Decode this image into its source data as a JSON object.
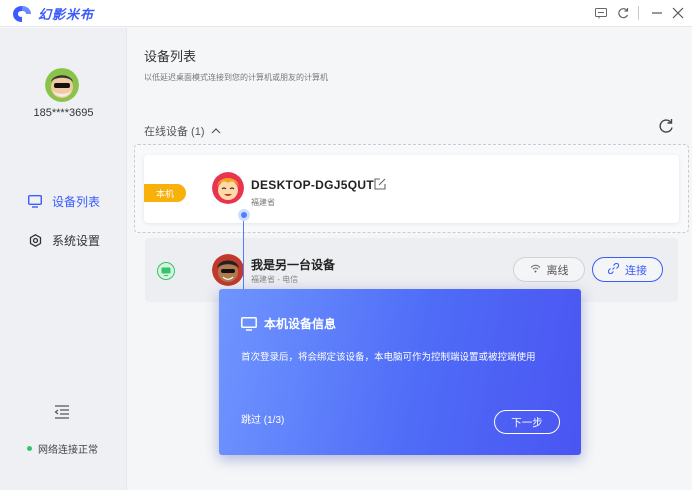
{
  "app": {
    "name": "幻影米布"
  },
  "window_controls": [
    {
      "name": "feedback-icon"
    },
    {
      "name": "refresh-app-icon"
    },
    {
      "name": "minimize-icon"
    },
    {
      "name": "close-icon"
    }
  ],
  "sidebar": {
    "user_phone": "185****3695",
    "items": [
      {
        "label": "设备列表",
        "icon": "monitor-icon",
        "active": true
      },
      {
        "label": "系统设置",
        "icon": "gear-icon",
        "active": false
      }
    ],
    "network_status": "网络连接正常"
  },
  "main": {
    "title": "设备列表",
    "subtitle": "以低延迟桌面模式连接到您的计算机或朋友的计算机",
    "online_header": "在线设备 (1)",
    "devices": [
      {
        "tag": "本机",
        "name": "DESKTOP-DGJ5QUT",
        "location": "福建省"
      },
      {
        "name": "我是另一台设备",
        "location": "福建省 - 电信",
        "offline_label": "离线",
        "connect_label": "连接"
      }
    ]
  },
  "guide": {
    "title": "本机设备信息",
    "body": "首次登录后，将会绑定该设备，本电脑可作为控制端设置或被控端使用",
    "step": "跳过 (1/3)",
    "next_label": "下一步"
  },
  "colors": {
    "accent": "#3b5bfd",
    "tag": "#f8b00b",
    "online": "#36c46a"
  }
}
